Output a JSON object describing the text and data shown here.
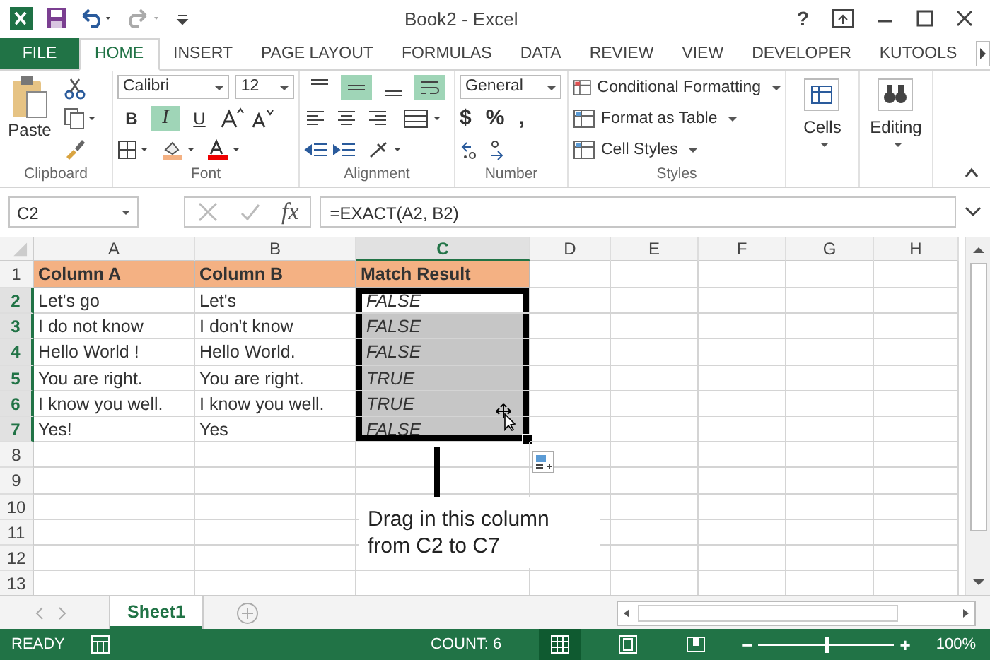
{
  "window": {
    "title": "Book2 - Excel",
    "help": "?"
  },
  "ribbon_tabs": [
    {
      "label": "FILE",
      "kind": "file",
      "selected": false
    },
    {
      "label": "HOME",
      "kind": "tab",
      "selected": true
    },
    {
      "label": "INSERT",
      "kind": "tab",
      "selected": false
    },
    {
      "label": "PAGE LAYOUT",
      "kind": "tab",
      "selected": false
    },
    {
      "label": "FORMULAS",
      "kind": "tab",
      "selected": false
    },
    {
      "label": "DATA",
      "kind": "tab",
      "selected": false
    },
    {
      "label": "REVIEW",
      "kind": "tab",
      "selected": false
    },
    {
      "label": "VIEW",
      "kind": "tab",
      "selected": false
    },
    {
      "label": "DEVELOPER",
      "kind": "tab",
      "selected": false
    },
    {
      "label": "KUTOOLS",
      "kind": "tab",
      "selected": false
    }
  ],
  "ribbon": {
    "clipboard": {
      "paste": "Paste",
      "label": "Clipboard"
    },
    "font": {
      "name": "Calibri",
      "size": "12",
      "styles": [
        {
          "label": "B",
          "selected": false
        },
        {
          "label": "I",
          "selected": true
        },
        {
          "label": "U",
          "selected": false
        }
      ],
      "label": "Font"
    },
    "alignment": {
      "top_row": [
        {
          "kind": "top",
          "selected": false
        },
        {
          "kind": "middle",
          "selected": true
        },
        {
          "kind": "bottom",
          "selected": false
        },
        {
          "kind": "wrap",
          "selected": true
        }
      ],
      "label": "Alignment"
    },
    "number": {
      "format": "General",
      "currency": "$",
      "percent": "%",
      "comma": ",",
      "label": "Number"
    },
    "styles": {
      "items": [
        "Conditional Formatting",
        "Format as Table",
        "Cell Styles"
      ],
      "label": "Styles"
    },
    "cells": {
      "label": "Cells"
    },
    "editing": {
      "label": "Editing"
    }
  },
  "formula_bar": {
    "name_box": "C2",
    "fx": "fx",
    "formula": "=EXACT(A2, B2)"
  },
  "columns": [
    {
      "label": "A",
      "selected": false
    },
    {
      "label": "B",
      "selected": false
    },
    {
      "label": "C",
      "selected": true
    },
    {
      "label": "D",
      "selected": false
    },
    {
      "label": "E",
      "selected": false
    },
    {
      "label": "F",
      "selected": false
    },
    {
      "label": "G",
      "selected": false
    },
    {
      "label": "H",
      "selected": false
    }
  ],
  "rows": [
    {
      "number": "1",
      "kind": "header",
      "selected": false,
      "cells": [
        {
          "text": "Column A",
          "selected": false,
          "active": false
        },
        {
          "text": "Column B",
          "selected": false,
          "active": false
        },
        {
          "text": "Match Result",
          "selected": false,
          "active": false
        }
      ]
    },
    {
      "number": "2",
      "kind": "data",
      "selected": true,
      "cells": [
        {
          "text": "Let's go",
          "selected": false,
          "active": false
        },
        {
          "text": "Let's",
          "selected": false,
          "active": false
        },
        {
          "text": "FALSE",
          "selected": true,
          "active": true
        }
      ]
    },
    {
      "number": "3",
      "kind": "data",
      "selected": true,
      "cells": [
        {
          "text": "I do not know",
          "selected": false,
          "active": false
        },
        {
          "text": "I don't know",
          "selected": false,
          "active": false
        },
        {
          "text": "FALSE",
          "selected": true,
          "active": false
        }
      ]
    },
    {
      "number": "4",
      "kind": "data",
      "selected": true,
      "cells": [
        {
          "text": "Hello World !",
          "selected": false,
          "active": false
        },
        {
          "text": "Hello World.",
          "selected": false,
          "active": false
        },
        {
          "text": "FALSE",
          "selected": true,
          "active": false
        }
      ]
    },
    {
      "number": "5",
      "kind": "data",
      "selected": true,
      "cells": [
        {
          "text": "You are right.",
          "selected": false,
          "active": false
        },
        {
          "text": "You are right.",
          "selected": false,
          "active": false
        },
        {
          "text": "TRUE",
          "selected": true,
          "active": false
        }
      ]
    },
    {
      "number": "6",
      "kind": "data",
      "selected": true,
      "cells": [
        {
          "text": "I know you well.",
          "selected": false,
          "active": false
        },
        {
          "text": "I know you well.",
          "selected": false,
          "active": false
        },
        {
          "text": "TRUE",
          "selected": true,
          "active": false
        }
      ]
    },
    {
      "number": "7",
      "kind": "data",
      "selected": true,
      "cells": [
        {
          "text": "Yes!",
          "selected": false,
          "active": false
        },
        {
          "text": "Yes",
          "selected": false,
          "active": false
        },
        {
          "text": "FALSE",
          "selected": true,
          "active": false
        }
      ]
    },
    {
      "number": "8",
      "kind": "data",
      "selected": false
    },
    {
      "number": "9",
      "kind": "data",
      "selected": false
    },
    {
      "number": "10",
      "kind": "data",
      "selected": false
    },
    {
      "number": "11",
      "kind": "data",
      "selected": false
    },
    {
      "number": "12",
      "kind": "data",
      "selected": false
    },
    {
      "number": "13",
      "kind": "data",
      "selected": false
    }
  ],
  "callout": {
    "text": "Drag in this column from C2 to C7"
  },
  "sheet_tabs": [
    {
      "label": "Sheet1",
      "selected": true
    }
  ],
  "status_bar": {
    "mode": "READY",
    "count": "COUNT: 6",
    "views": [
      {
        "kind": "normal",
        "selected": true
      },
      {
        "kind": "page_layout",
        "selected": false
      },
      {
        "kind": "page_break",
        "selected": false
      }
    ],
    "zoom_slider": {
      "minus": "−",
      "plus": "+",
      "level": 0.5
    },
    "zoom": "100%"
  }
}
